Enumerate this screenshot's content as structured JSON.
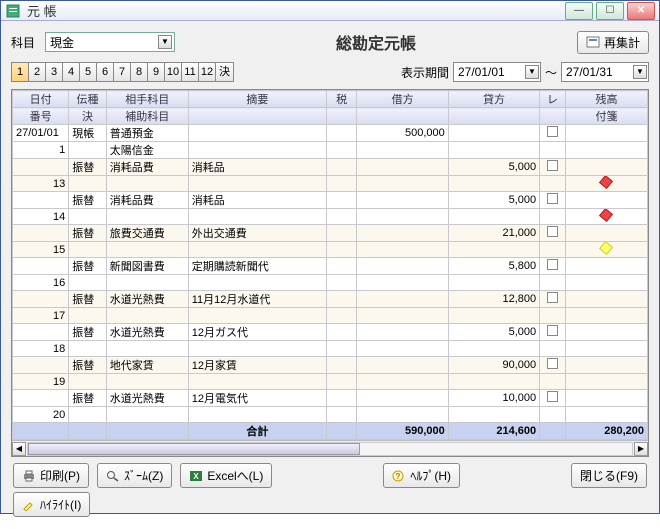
{
  "window": {
    "title": "元 帳"
  },
  "header": {
    "subject_label": "科目",
    "subject_value": "現金",
    "main_title": "総勘定元帳",
    "recalc_label": "再集計"
  },
  "months": {
    "items": [
      "1",
      "2",
      "3",
      "4",
      "5",
      "6",
      "7",
      "8",
      "9",
      "10",
      "11",
      "12",
      "決"
    ],
    "selected": 0
  },
  "period": {
    "label": "表示期間",
    "from": "27/01/01",
    "sep": "〜",
    "to": "27/01/31"
  },
  "columns": {
    "r1": [
      "日付",
      "伝種",
      "相手科目",
      "摘要",
      "税",
      "借方",
      "貸方",
      "レ",
      "残高"
    ],
    "r2": [
      "番号",
      "決",
      "補助科目",
      "",
      "",
      "",
      "",
      "",
      "付箋"
    ]
  },
  "rows": [
    {
      "date": "27/01/01",
      "no": "1",
      "type": "現帳",
      "dec": "",
      "acct": "普通預金",
      "sub": "太陽信金",
      "desc": "",
      "tax": "",
      "debit": "500,000",
      "credit": "",
      "chk": true,
      "bal": "",
      "pin": ""
    },
    {
      "date": "",
      "no": "13",
      "type": "振替",
      "dec": "",
      "acct": "消耗品費",
      "sub": "",
      "desc": "消耗品",
      "tax": "",
      "debit": "",
      "credit": "5,000",
      "chk": true,
      "bal": "",
      "pin": "red"
    },
    {
      "date": "",
      "no": "14",
      "type": "振替",
      "dec": "",
      "acct": "消耗品費",
      "sub": "",
      "desc": "消耗品",
      "tax": "",
      "debit": "",
      "credit": "5,000",
      "chk": true,
      "bal": "",
      "pin": "red"
    },
    {
      "date": "",
      "no": "15",
      "type": "振替",
      "dec": "",
      "acct": "旅費交通費",
      "sub": "",
      "desc": "外出交通費",
      "tax": "",
      "debit": "",
      "credit": "21,000",
      "chk": true,
      "bal": "",
      "pin": "yel"
    },
    {
      "date": "",
      "no": "16",
      "type": "振替",
      "dec": "",
      "acct": "新聞図書費",
      "sub": "",
      "desc": "定期購読新聞代",
      "tax": "",
      "debit": "",
      "credit": "5,800",
      "chk": true,
      "bal": "",
      "pin": ""
    },
    {
      "date": "",
      "no": "17",
      "type": "振替",
      "dec": "",
      "acct": "水道光熱費",
      "sub": "",
      "desc": "11月12月水道代",
      "tax": "",
      "debit": "",
      "credit": "12,800",
      "chk": true,
      "bal": "",
      "pin": ""
    },
    {
      "date": "",
      "no": "18",
      "type": "振替",
      "dec": "",
      "acct": "水道光熱費",
      "sub": "",
      "desc": "12月ガス代",
      "tax": "",
      "debit": "",
      "credit": "5,000",
      "chk": true,
      "bal": "",
      "pin": ""
    },
    {
      "date": "",
      "no": "19",
      "type": "振替",
      "dec": "",
      "acct": "地代家賃",
      "sub": "",
      "desc": "12月家賃",
      "tax": "",
      "debit": "",
      "credit": "90,000",
      "chk": true,
      "bal": "",
      "pin": ""
    },
    {
      "date": "",
      "no": "20",
      "type": "振替",
      "dec": "",
      "acct": "水道光熱費",
      "sub": "",
      "desc": "12月電気代",
      "tax": "",
      "debit": "",
      "credit": "10,000",
      "chk": true,
      "bal": "",
      "pin": ""
    }
  ],
  "total": {
    "label": "合計",
    "debit": "590,000",
    "credit": "214,600",
    "balance": "280,200"
  },
  "footer": {
    "print": "印刷(P)",
    "zoom": "ｽﾞｰﾑ(Z)",
    "excel": "Excelへ(L)",
    "help": "ﾍﾙﾌﾟ(H)",
    "close": "閉じる(F9)",
    "highlight": "ﾊｲﾗｲﾄ(I)"
  }
}
